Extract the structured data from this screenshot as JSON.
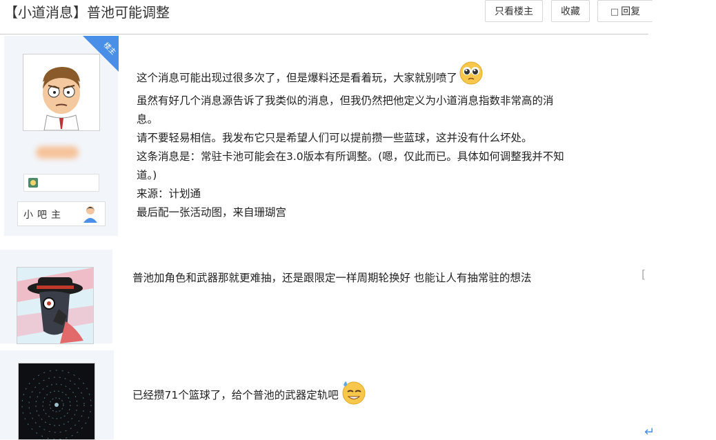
{
  "thread": {
    "title": "【小道消息】普池可能调整"
  },
  "toolbar": {
    "only_op_label": "只看楼主",
    "favorite_label": "收藏",
    "reply_label": "回复"
  },
  "posts": [
    {
      "op_tag": "楼主",
      "rank_label": "小吧主",
      "lines": [
        "这个消息可能出现过很多次了，但是爆料还是看着玩，大家就别喷了",
        "虽然有好几个消息源告诉了我类似的消息，但我仍然把他定义为小道消息指数非常高的消",
        "息。",
        "请不要轻易相信。我发布它只是希望人们可以提前攒一些蓝球，这并没有什么坏处。",
        "这条消息是：常驻卡池可能会在3.0版本有所调整。(嗯，仅此而已。具体如何调整我并不知",
        "道。)",
        "来源：计划通",
        "最后配一张活动图，来自珊瑚宫"
      ],
      "emoji": "pleading-face-icon"
    },
    {
      "text": "普池加角色和武器那就更难抽，还是跟限定一样周期轮换好 也能让人有抽常驻的想法",
      "side_marker": "["
    },
    {
      "text": "已经攒71个篮球了，给个普池的武器定轨吧",
      "emoji": "sweat-smile-face-icon"
    }
  ],
  "colors": {
    "accent": "#4a8fe7",
    "side_bg": "#f2f5fa"
  }
}
